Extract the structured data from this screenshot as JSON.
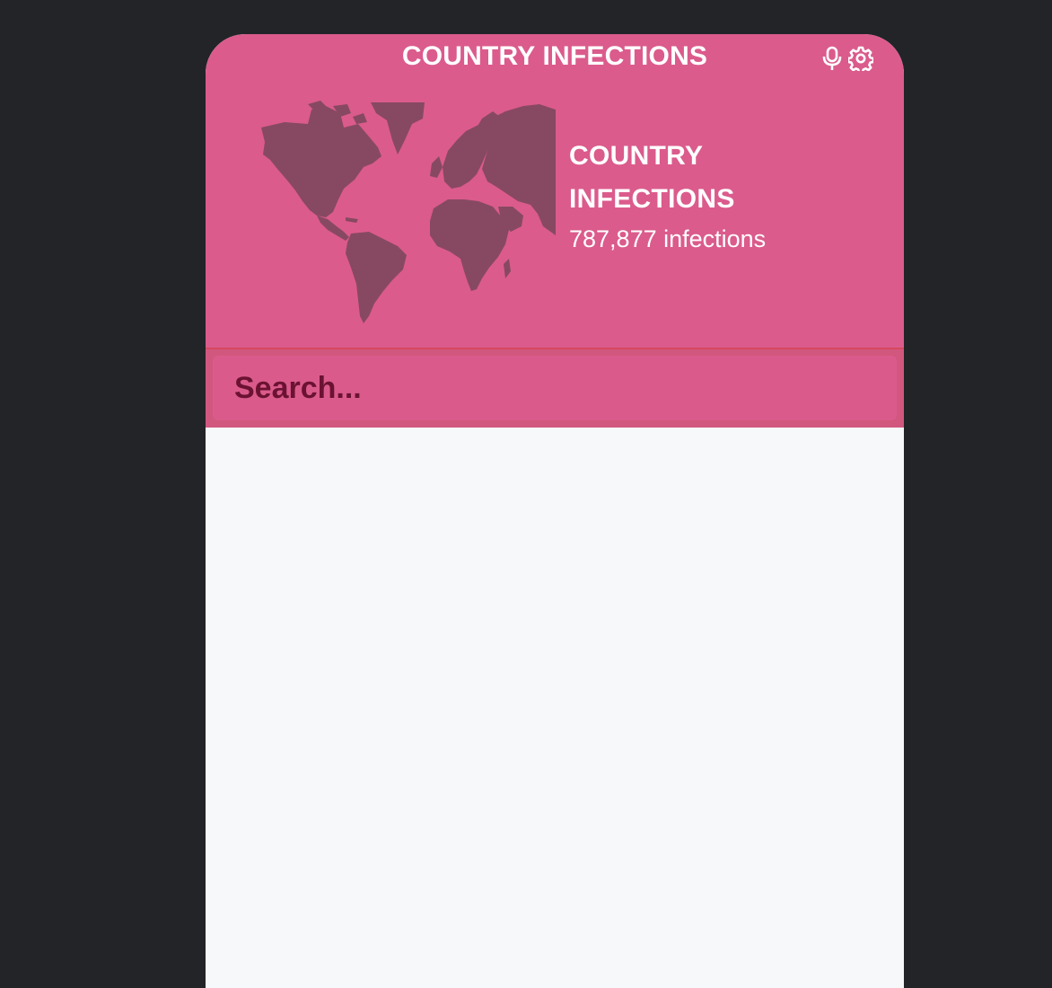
{
  "app": {
    "title": "COUNTRY INFECTIONS"
  },
  "toolbar": {
    "mic_icon": "microphone-icon",
    "settings_icon": "gear-icon"
  },
  "hero": {
    "title": "COUNTRY INFECTIONS",
    "count_text": "787,877 infections",
    "map_icon": "world-map-icon"
  },
  "search": {
    "placeholder": "Search...",
    "value": ""
  },
  "countries": [],
  "colors": {
    "header_bg": "#db5b8c",
    "search_band_bg": "#d1577e",
    "search_text": "#6b1232",
    "map_fill": "#874961",
    "page_bg": "#222428",
    "list_bg": "#f7f8fa"
  }
}
